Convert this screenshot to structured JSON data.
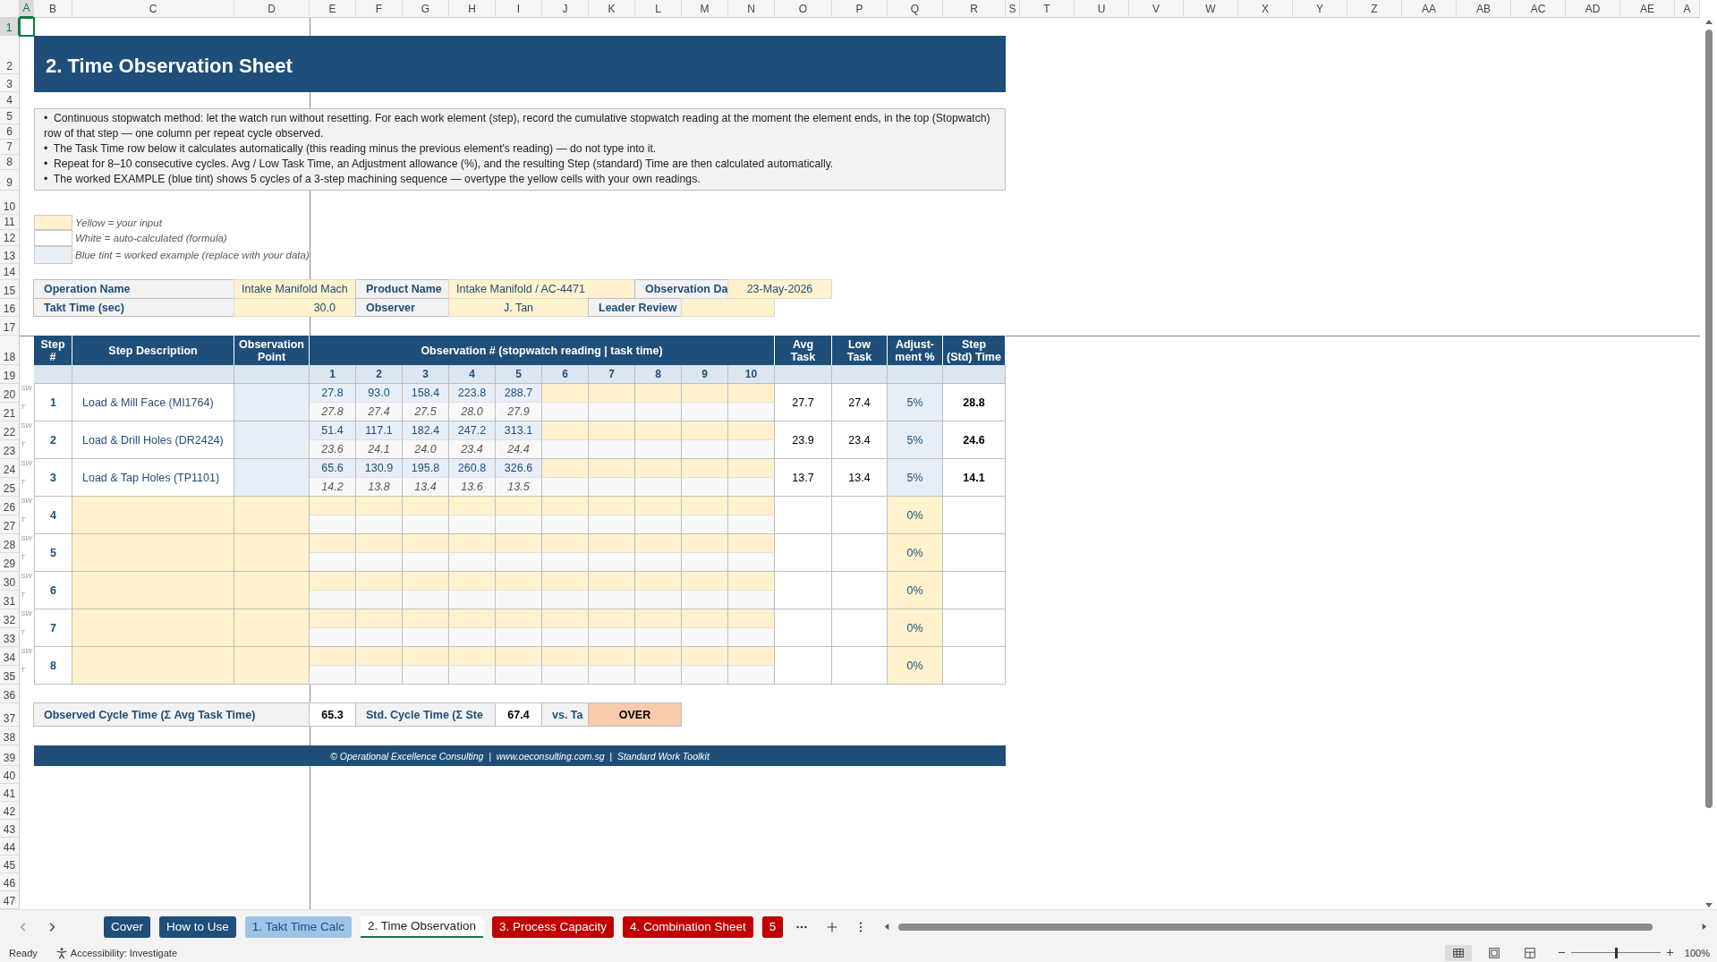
{
  "column_headers": [
    {
      "label": "A",
      "selected": true
    },
    {
      "label": "B",
      "selected": false
    },
    {
      "label": "C",
      "selected": false
    },
    {
      "label": "D",
      "selected": false
    },
    {
      "label": "E",
      "selected": false
    },
    {
      "label": "F",
      "selected": false
    },
    {
      "label": "G",
      "selected": false
    },
    {
      "label": "H",
      "selected": false
    },
    {
      "label": "I",
      "selected": false
    },
    {
      "label": "J",
      "selected": false
    },
    {
      "label": "K",
      "selected": false
    },
    {
      "label": "L",
      "selected": false
    },
    {
      "label": "M",
      "selected": false
    },
    {
      "label": "N",
      "selected": false
    },
    {
      "label": "O",
      "selected": false
    },
    {
      "label": "P",
      "selected": false
    },
    {
      "label": "Q",
      "selected": false
    },
    {
      "label": "R",
      "selected": false
    },
    {
      "label": "S",
      "selected": false
    },
    {
      "label": "T",
      "selected": false
    },
    {
      "label": "U",
      "selected": false
    },
    {
      "label": "V",
      "selected": false
    },
    {
      "label": "W",
      "selected": false
    },
    {
      "label": "X",
      "selected": false
    },
    {
      "label": "Y",
      "selected": false
    },
    {
      "label": "Z",
      "selected": false
    },
    {
      "label": "AA",
      "selected": false
    },
    {
      "label": "AB",
      "selected": false
    },
    {
      "label": "AC",
      "selected": false
    },
    {
      "label": "AD",
      "selected": false
    },
    {
      "label": "AE",
      "selected": false
    },
    {
      "label": "A",
      "selected": false
    }
  ],
  "row_numbers": [
    {
      "label": "1",
      "selected": true
    },
    {
      "label": "2",
      "selected": false
    },
    {
      "label": "3",
      "selected": false
    },
    {
      "label": "4",
      "selected": false
    },
    {
      "label": "5",
      "selected": false
    },
    {
      "label": "6",
      "selected": false
    },
    {
      "label": "7",
      "selected": false
    },
    {
      "label": "8",
      "selected": false
    },
    {
      "label": "9",
      "selected": false
    },
    {
      "label": "10",
      "selected": false
    },
    {
      "label": "11",
      "selected": false
    },
    {
      "label": "12",
      "selected": false
    },
    {
      "label": "13",
      "selected": false
    },
    {
      "label": "14",
      "selected": false
    },
    {
      "label": "15",
      "selected": false
    },
    {
      "label": "16",
      "selected": false
    },
    {
      "label": "17",
      "selected": false
    },
    {
      "label": "18",
      "selected": false
    },
    {
      "label": "19",
      "selected": false
    },
    {
      "label": "20",
      "selected": false
    },
    {
      "label": "21",
      "selected": false
    },
    {
      "label": "22",
      "selected": false
    },
    {
      "label": "23",
      "selected": false
    },
    {
      "label": "24",
      "selected": false
    },
    {
      "label": "25",
      "selected": false
    },
    {
      "label": "26",
      "selected": false
    },
    {
      "label": "27",
      "selected": false
    },
    {
      "label": "28",
      "selected": false
    },
    {
      "label": "29",
      "selected": false
    },
    {
      "label": "30",
      "selected": false
    },
    {
      "label": "31",
      "selected": false
    },
    {
      "label": "32",
      "selected": false
    },
    {
      "label": "33",
      "selected": false
    },
    {
      "label": "34",
      "selected": false
    },
    {
      "label": "35",
      "selected": false
    },
    {
      "label": "36",
      "selected": false
    },
    {
      "label": "37",
      "selected": false
    },
    {
      "label": "38",
      "selected": false
    },
    {
      "label": "39",
      "selected": false
    },
    {
      "label": "40",
      "selected": false
    },
    {
      "label": "41",
      "selected": false
    },
    {
      "label": "42",
      "selected": false
    },
    {
      "label": "43",
      "selected": false
    },
    {
      "label": "44",
      "selected": false
    },
    {
      "label": "45",
      "selected": false
    },
    {
      "label": "46",
      "selected": false
    },
    {
      "label": "47",
      "selected": false
    }
  ],
  "title": "2. Time Observation Sheet",
  "instructions": [
    "•  Continuous stopwatch method: let the watch run without resetting. For each work element (step), record the cumulative stopwatch reading at the moment the element ends, in the top (Stopwatch) row of that step — one column per repeat cycle observed.",
    "•  The Task Time row below it calculates automatically (this reading minus the previous element's reading) — do not type into it.",
    "•  Repeat for 8–10 consecutive cycles. Avg / Low Task Time, an Adjustment allowance (%), and the resulting Step (standard) Time are then calculated automatically.",
    "•  The worked EXAMPLE (blue tint) shows 5 cycles of a 3-step machining sequence — overtype the yellow cells with your own readings."
  ],
  "legend": [
    {
      "label": "Yellow = your input",
      "color": "#fff2cc"
    },
    {
      "label": "White = auto-calculated (formula)",
      "color": "#ffffff"
    },
    {
      "label": "Blue tint = worked example (replace with your data)",
      "color": "#e8eef7"
    }
  ],
  "header_fields": [
    [
      {
        "label": "Operation Name",
        "value": "Intake Manifold Mach"
      },
      {
        "label": "Product Name",
        "value": "Intake Manifold / AC-4471"
      },
      {
        "label": "Observation Da",
        "value": "23-May-2026"
      }
    ],
    [
      {
        "label": "Takt Time (sec)",
        "value": "30.0"
      },
      {
        "label": "Observer",
        "value": "J. Tan"
      },
      {
        "label": "Leader Review"
      }
    ]
  ],
  "table": {
    "columns": [
      {
        "lines": [
          "Step",
          "#"
        ]
      },
      {
        "lines": [
          "Step Description"
        ]
      },
      {
        "lines": [
          "Observation",
          "Point"
        ]
      },
      {
        "lines": [
          "Observation # (stopwatch reading | task time)"
        ]
      },
      {
        "lines": [
          "Avg",
          "Task"
        ]
      },
      {
        "lines": [
          "Low",
          "Task"
        ]
      },
      {
        "lines": [
          "Adjust-",
          "ment %"
        ]
      },
      {
        "lines": [
          "Step",
          "(Std) Time"
        ]
      }
    ],
    "observation_numbers": [
      "1",
      "2",
      "3",
      "4",
      "5",
      "6",
      "7",
      "8",
      "9",
      "10"
    ],
    "steps": [
      {
        "number": "1",
        "kind": "example",
        "description": "Load & Mill Face (MI1764)",
        "sw_label": "SW",
        "t_label": "T",
        "readings": [
          "27.8",
          "93.0",
          "158.4",
          "223.8",
          "288.7"
        ],
        "task_times": [
          "27.8",
          "27.4",
          "27.5",
          "28.0",
          "27.9"
        ],
        "avg": "27.7",
        "low": "27.4",
        "adjustment": "5%",
        "std_time": "28.8"
      },
      {
        "number": "2",
        "kind": "example",
        "description": "Load & Drill Holes (DR2424)",
        "sw_label": "SW",
        "t_label": "T",
        "readings": [
          "51.4",
          "117.1",
          "182.4",
          "247.2",
          "313.1"
        ],
        "task_times": [
          "23.6",
          "24.1",
          "24.0",
          "23.4",
          "24.4"
        ],
        "avg": "23.9",
        "low": "23.4",
        "adjustment": "5%",
        "std_time": "24.6"
      },
      {
        "number": "3",
        "kind": "example",
        "description": "Load & Tap Holes (TP1101)",
        "sw_label": "SW",
        "t_label": "T",
        "readings": [
          "65.6",
          "130.9",
          "195.8",
          "260.8",
          "326.6"
        ],
        "task_times": [
          "14.2",
          "13.8",
          "13.4",
          "13.6",
          "13.5"
        ],
        "avg": "13.7",
        "low": "13.4",
        "adjustment": "5%",
        "std_time": "14.1"
      },
      {
        "number": "4",
        "kind": "input",
        "sw_label": "SW",
        "t_label": "T",
        "adjustment": "0%"
      },
      {
        "number": "5",
        "kind": "input",
        "sw_label": "SW",
        "t_label": "T",
        "adjustment": "0%"
      },
      {
        "number": "6",
        "kind": "input",
        "sw_label": "SW",
        "t_label": "T",
        "adjustment": "0%"
      },
      {
        "number": "7",
        "kind": "input",
        "sw_label": "SW",
        "t_label": "T",
        "adjustment": "0%"
      },
      {
        "number": "8",
        "kind": "input",
        "sw_label": "SW",
        "t_label": "T",
        "adjustment": "0%"
      }
    ]
  },
  "summary": {
    "observed_label": "Observed Cycle Time (Σ Avg Task Time)",
    "observed_value": "65.3",
    "std_label": "Std. Cycle Time (Σ Ste",
    "std_value": "67.4",
    "vs_label": "vs. Ta",
    "status": "OVER"
  },
  "footer": "© Operational Excellence Consulting  |  www.oeconsulting.com.sg  |  Standard Work Toolkit",
  "sheet_tabs": [
    {
      "label": "Cover",
      "color": "#1f4e79",
      "selected": false
    },
    {
      "label": "How to Use",
      "color": "#1f4e79",
      "selected": false
    },
    {
      "label": "1. Takt Time Calc",
      "color": "#9dc3e6",
      "selected": false
    },
    {
      "label": "2. Time Observation",
      "color": "#217346",
      "selected": true
    },
    {
      "label": "3. Process Capacity",
      "color": "#c00000",
      "selected": false
    },
    {
      "label": "4. Combination Sheet",
      "color": "#c00000",
      "selected": false
    },
    {
      "label": "5",
      "color": "#c00000",
      "selected": false
    }
  ],
  "status_bar": {
    "ready": "Ready",
    "accessibility": "Accessibility: Investigate",
    "views": [
      {
        "kind": "normal",
        "selected": true
      },
      {
        "kind": "page_layout",
        "selected": false
      },
      {
        "kind": "page_break",
        "selected": false
      }
    ],
    "zoom": {
      "level": 0.5,
      "label": "100%"
    }
  }
}
